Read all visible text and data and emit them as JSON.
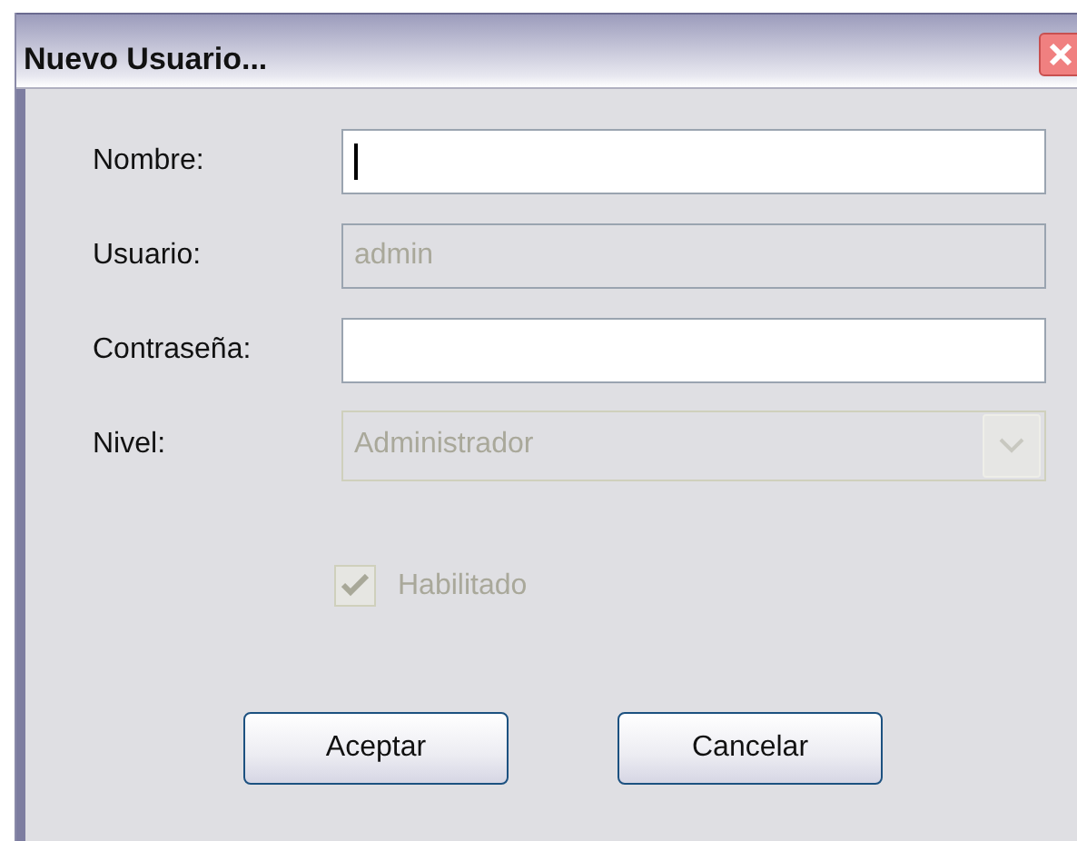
{
  "window": {
    "title": "Nuevo Usuario..."
  },
  "fields": [
    {
      "label": "Nombre:",
      "kind": "text",
      "disabled": false,
      "focused": true
    },
    {
      "label": "Usuario:",
      "kind": "text",
      "value": "admin",
      "disabled": true,
      "focused": false
    },
    {
      "label": "Contraseña:",
      "kind": "text",
      "disabled": false,
      "focused": false
    },
    {
      "label": "Nivel:",
      "kind": "select",
      "value": "Administrador",
      "disabled": true
    }
  ],
  "checkbox": {
    "label": "Habilitado",
    "checked": true,
    "disabled": true
  },
  "buttons": [
    "Aceptar",
    "Cancelar"
  ]
}
